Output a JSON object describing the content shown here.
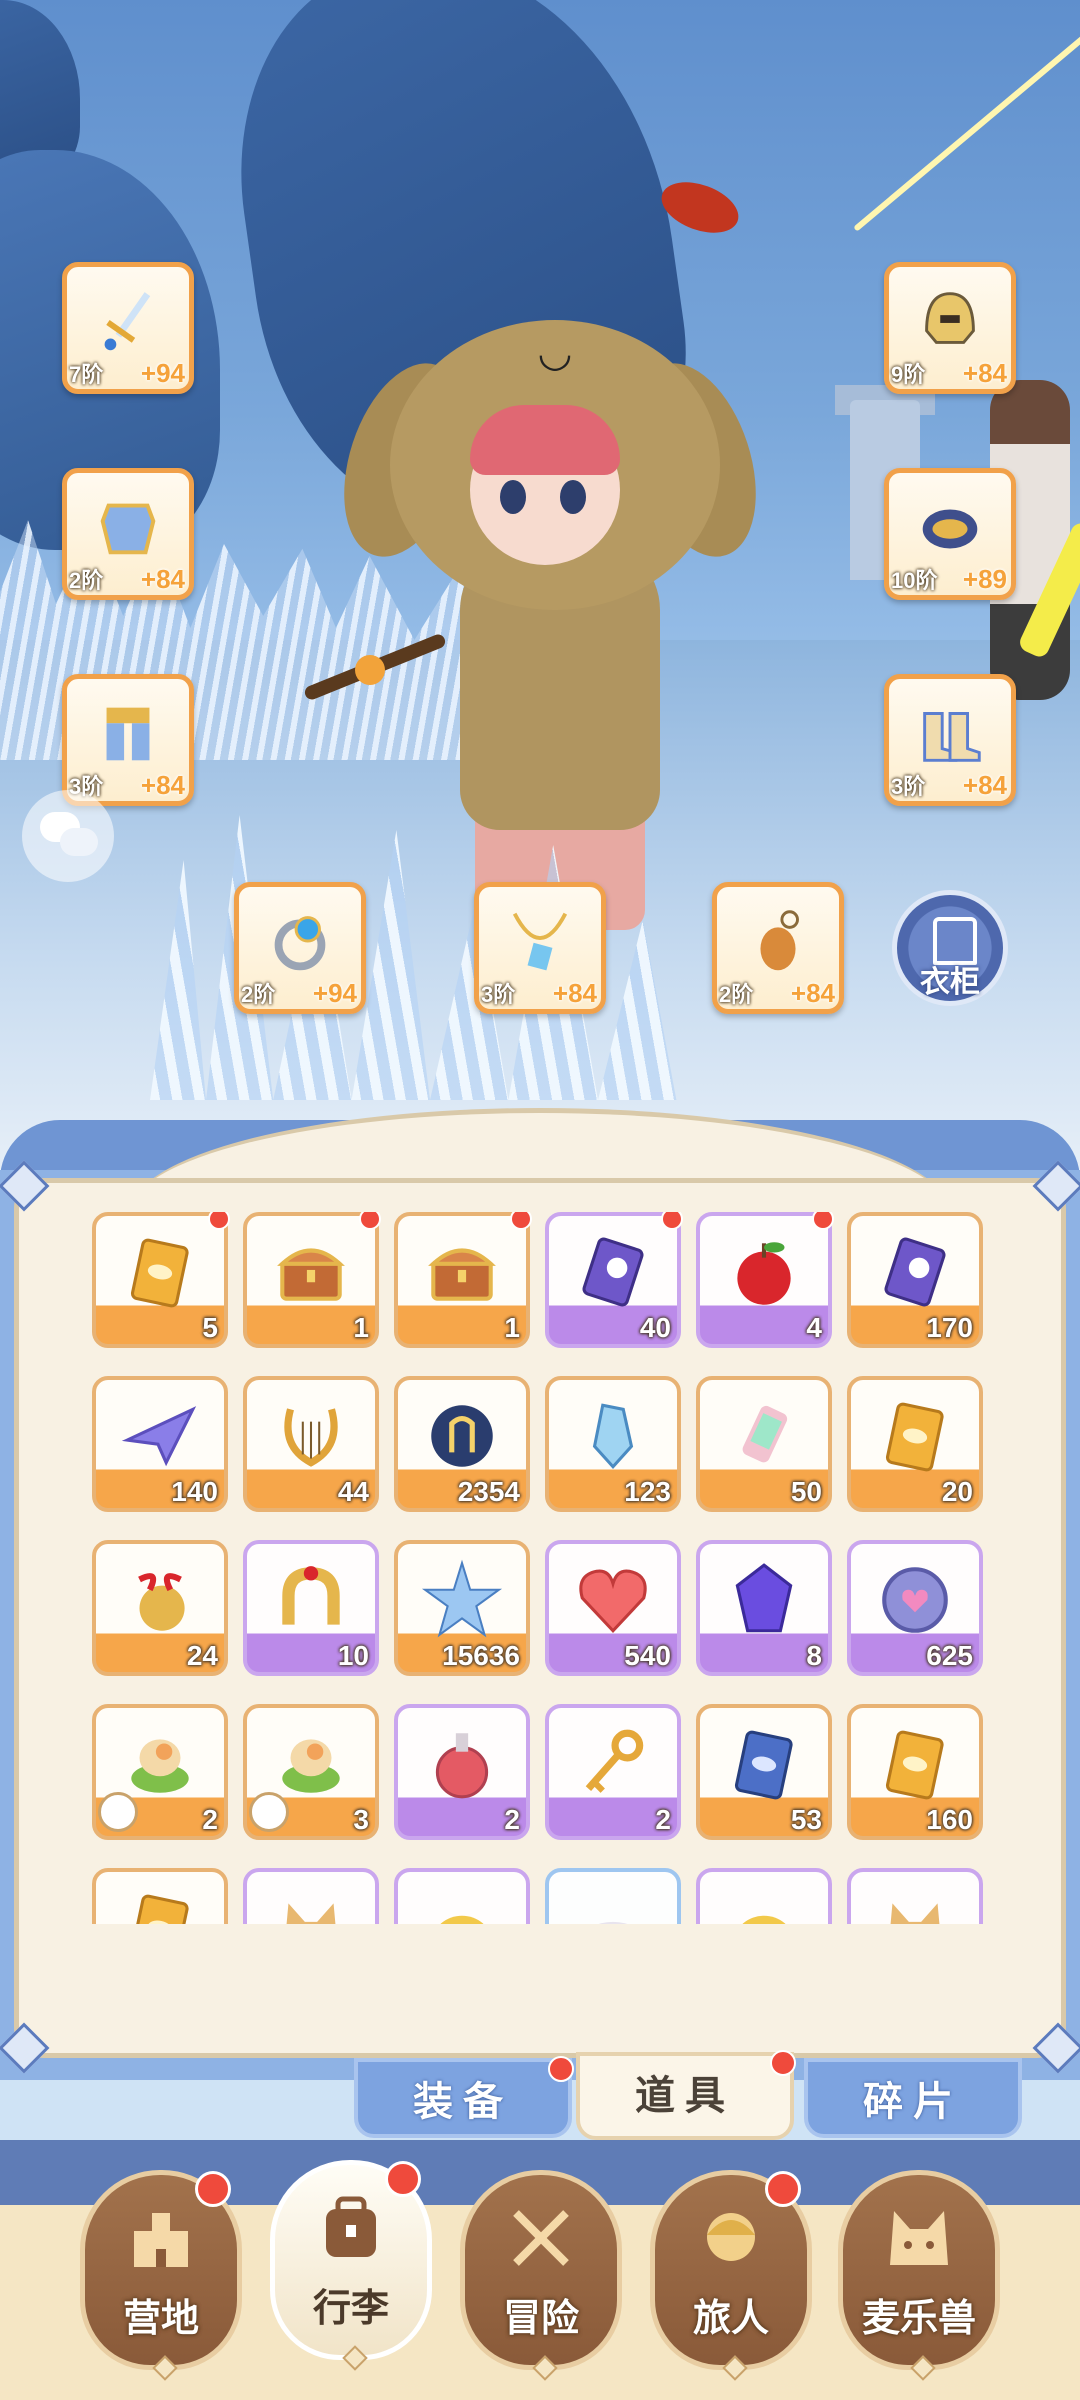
{
  "colors": {
    "orange_rarity": "#f6a64a",
    "purple_rarity": "#bb8ae9",
    "blue_rarity": "#7fb4ea",
    "badge_red": "#ef4a3c",
    "panel_cream": "#f8f1e3"
  },
  "equipment": {
    "weapon": {
      "icon": "sword-icon",
      "tier": "7阶",
      "bonus": "+94"
    },
    "armor": {
      "icon": "armor-icon",
      "tier": "2阶",
      "bonus": "+84"
    },
    "pants": {
      "icon": "leg-armor-icon",
      "tier": "3阶",
      "bonus": "+84"
    },
    "helmet": {
      "icon": "helmet-icon",
      "tier": "9阶",
      "bonus": "+84"
    },
    "gloves": {
      "icon": "gauntlet-icon",
      "tier": "10阶",
      "bonus": "+89"
    },
    "boots": {
      "icon": "boots-icon",
      "tier": "3阶",
      "bonus": "+84"
    },
    "ring": {
      "icon": "ring-icon",
      "tier": "2阶",
      "bonus": "+94"
    },
    "necklace": {
      "icon": "necklace-icon",
      "tier": "3阶",
      "bonus": "+84"
    },
    "trinket": {
      "icon": "trinket-icon",
      "tier": "2阶",
      "bonus": "+84"
    }
  },
  "wardrobe": {
    "label": "衣柜",
    "icon": "wardrobe-icon"
  },
  "chat": {
    "icon": "chat-bubbles-icon"
  },
  "inventory": {
    "items": [
      {
        "icon": "gold-card-icon",
        "count": "5",
        "rarity": "orange",
        "new": true
      },
      {
        "icon": "treasure-chest-icon",
        "count": "1",
        "rarity": "orange",
        "new": true
      },
      {
        "icon": "ornate-chest-icon",
        "count": "1",
        "rarity": "orange",
        "new": true
      },
      {
        "icon": "moon-ticket-icon",
        "count": "40",
        "rarity": "purple",
        "new": true
      },
      {
        "icon": "apple-icon",
        "count": "4",
        "rarity": "purple",
        "new": true
      },
      {
        "icon": "purple-ticket-icon",
        "count": "170",
        "rarity": "orange",
        "new": false
      },
      {
        "icon": "paper-plane-icon",
        "count": "140",
        "rarity": "orange",
        "new": false
      },
      {
        "icon": "lyre-icon",
        "count": "44",
        "rarity": "orange",
        "new": false
      },
      {
        "icon": "gem-orb-icon",
        "count": "2354",
        "rarity": "orange",
        "new": false
      },
      {
        "icon": "crystal-icon",
        "count": "123",
        "rarity": "orange",
        "new": false
      },
      {
        "icon": "paint-tube-icon",
        "count": "50",
        "rarity": "orange",
        "new": false
      },
      {
        "icon": "outfit-card-icon",
        "count": "20",
        "rarity": "orange",
        "new": false
      },
      {
        "icon": "bell-icon",
        "count": "24",
        "rarity": "orange",
        "new": false
      },
      {
        "icon": "horseshoe-icon",
        "count": "10",
        "rarity": "purple",
        "new": false
      },
      {
        "icon": "star-crystal-icon",
        "count": "15636",
        "rarity": "orange",
        "new": false
      },
      {
        "icon": "heart-icon",
        "count": "540",
        "rarity": "purple",
        "new": false
      },
      {
        "icon": "purple-gem-icon",
        "count": "8",
        "rarity": "purple",
        "new": false
      },
      {
        "icon": "heart-coin-icon",
        "count": "625",
        "rarity": "purple",
        "new": false
      },
      {
        "icon": "food-bowl-icon",
        "count": "2",
        "rarity": "orange",
        "new": false
      },
      {
        "icon": "food-bowl-icon",
        "count": "3",
        "rarity": "orange",
        "new": false
      },
      {
        "icon": "potion-icon",
        "count": "2",
        "rarity": "purple",
        "new": false
      },
      {
        "icon": "gold-key-icon",
        "count": "2",
        "rarity": "purple",
        "new": false
      },
      {
        "icon": "blue-card-icon",
        "count": "53",
        "rarity": "orange",
        "new": false
      },
      {
        "icon": "gold-card-icon",
        "count": "160",
        "rarity": "orange",
        "new": false
      },
      {
        "icon": "orange-card-icon",
        "count": "",
        "rarity": "orange",
        "new": false
      },
      {
        "icon": "cat-mask-icon",
        "count": "",
        "rarity": "purple",
        "new": false
      },
      {
        "icon": "yellow-item-icon",
        "count": "",
        "rarity": "purple",
        "new": false
      },
      {
        "icon": "cloud-item-icon",
        "count": "",
        "rarity": "blue",
        "new": false
      },
      {
        "icon": "leaf-item-icon",
        "count": "",
        "rarity": "purple",
        "new": false
      },
      {
        "icon": "cat-mask-icon",
        "count": "",
        "rarity": "purple",
        "new": false
      }
    ]
  },
  "tabs": [
    {
      "label": "装备",
      "active": false,
      "badge": true
    },
    {
      "label": "道具",
      "active": true,
      "badge": true
    },
    {
      "label": "碎片",
      "active": false,
      "badge": false
    }
  ],
  "nav": [
    {
      "label": "营地",
      "icon": "castle-icon",
      "active": false,
      "badge": true
    },
    {
      "label": "行李",
      "icon": "backpack-icon",
      "active": true,
      "badge": true
    },
    {
      "label": "冒险",
      "icon": "crossed-swords-icon",
      "active": false,
      "badge": false
    },
    {
      "label": "旅人",
      "icon": "traveler-icon",
      "active": false,
      "badge": true
    },
    {
      "label": "麦乐兽",
      "icon": "cat-face-icon",
      "active": false,
      "badge": false
    }
  ]
}
